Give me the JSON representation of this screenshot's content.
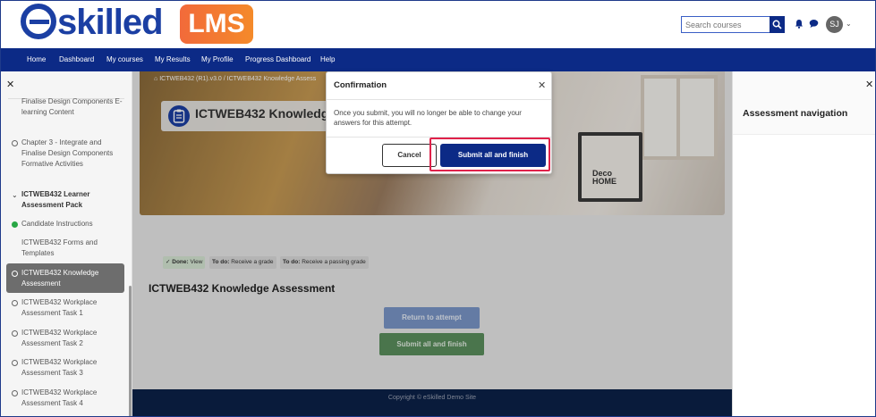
{
  "brand": {
    "logo": "eskilled",
    "badge": "LMS"
  },
  "header": {
    "search_placeholder": "Search courses",
    "avatar_initials": "SJ",
    "icons": [
      "search-icon",
      "bell-icon",
      "chat-icon",
      "chevron-down-icon"
    ]
  },
  "nav": {
    "items": [
      {
        "label": "Home"
      },
      {
        "label": "Dashboard"
      },
      {
        "label": "My courses"
      },
      {
        "label": "My Results"
      },
      {
        "label": "My Profile"
      },
      {
        "label": "Progress Dashboard"
      },
      {
        "label": "Help"
      }
    ]
  },
  "course_index": {
    "items": [
      {
        "label": "Finalise Design Components E-learning Content"
      },
      {
        "label": "Chapter 3 - Integrate and Finalise Design Components Formative Activities"
      },
      {
        "label": "ICTWEB432 Learner Assessment Pack"
      },
      {
        "label": "Candidate Instructions"
      },
      {
        "label": "ICTWEB432 Forms and Templates"
      },
      {
        "label": "ICTWEB432 Knowledge Assessment"
      },
      {
        "label": "ICTWEB432 Workplace Assessment Task 1"
      },
      {
        "label": "ICTWEB432 Workplace Assessment Task 2"
      },
      {
        "label": "ICTWEB432 Workplace Assessment Task 3"
      },
      {
        "label": "ICTWEB432 Workplace Assessment Task 4"
      }
    ]
  },
  "main": {
    "breadcrumb": "ICTWEB432 (R1).v3.0 / ICTWEB432 Knowledge Assess",
    "page_title": "ICTWEB432 Knowledge A",
    "hero_monitor_text_1": "Deco",
    "hero_monitor_text_2": "HOME",
    "status": {
      "done_label": "Done:",
      "done_value": "View",
      "todo1_label": "To do:",
      "todo1_value": "Receive a grade",
      "todo2_label": "To do:",
      "todo2_value": "Receive a passing grade"
    },
    "content_title": "ICTWEB432 Knowledge Assessment",
    "return_button": "Return to attempt",
    "submit_button": "Submit all and finish",
    "footer": "Copyright © eSkilled Demo Site"
  },
  "right_drawer": {
    "title": "Assessment navigation"
  },
  "modal": {
    "title": "Confirmation",
    "body": "Once you submit, you will no longer be able to change your answers for this attempt.",
    "cancel": "Cancel",
    "confirm": "Submit all and finish"
  },
  "colors": {
    "primary": "#0c2a86",
    "accent": "#f26a3a",
    "highlight": "#e0224a",
    "done": "#28a745"
  }
}
